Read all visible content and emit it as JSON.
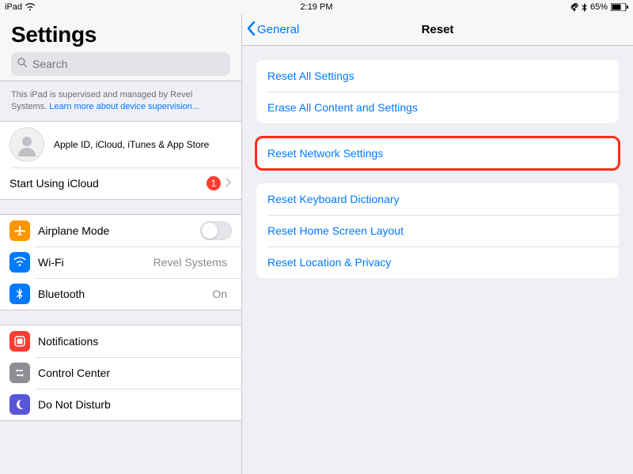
{
  "status": {
    "device": "iPad",
    "time": "2:19 PM",
    "battery_pct": "65%"
  },
  "sidebar": {
    "title": "Settings",
    "search_placeholder": "Search",
    "supervise_text": "This iPad is supervised and managed by Revel Systems.",
    "supervise_link": "Learn more about device supervision...",
    "apple_id_label": "Apple ID, iCloud, iTunes & App Store",
    "icloud_row": {
      "label": "Start Using iCloud",
      "badge": "1"
    },
    "conn": {
      "airplane": "Airplane Mode",
      "wifi": "Wi-Fi",
      "wifi_value": "Revel Systems",
      "bluetooth": "Bluetooth",
      "bluetooth_value": "On"
    },
    "sys": {
      "notifications": "Notifications",
      "control_center": "Control Center",
      "dnd": "Do Not Disturb"
    }
  },
  "detail": {
    "back_label": "General",
    "title": "Reset",
    "group1": {
      "reset_all": "Reset All Settings",
      "erase_all": "Erase All Content and Settings"
    },
    "group2": {
      "reset_network": "Reset Network Settings"
    },
    "group3": {
      "reset_keyboard": "Reset Keyboard Dictionary",
      "reset_home": "Reset Home Screen Layout",
      "reset_location": "Reset Location & Privacy"
    }
  }
}
